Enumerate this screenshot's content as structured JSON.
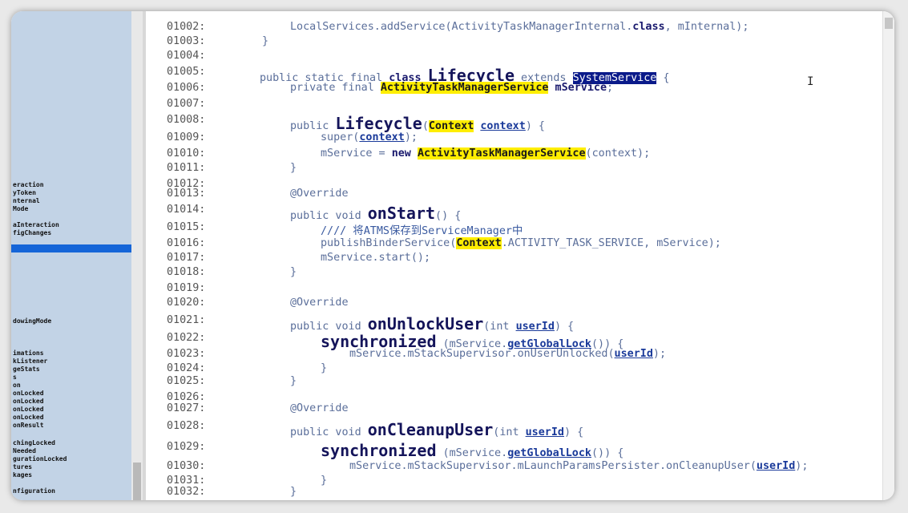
{
  "sidebar": {
    "items": [
      {
        "text": "eraction"
      },
      {
        "text": "yToken"
      },
      {
        "text": "nternal"
      },
      {
        "text": "Mode"
      },
      {
        "text": "aInteraction"
      },
      {
        "text": "figChanges"
      },
      {
        "text": "dowingMode"
      },
      {
        "text": "imations"
      },
      {
        "text": "kListener"
      },
      {
        "text": "geStats"
      },
      {
        "text": "s"
      },
      {
        "text": "on"
      },
      {
        "text": "onLocked"
      },
      {
        "text": "onLocked"
      },
      {
        "text": "onLocked"
      },
      {
        "text": "onLocked"
      },
      {
        "text": "onResult"
      },
      {
        "text": "chingLocked"
      },
      {
        "text": "Needed"
      },
      {
        "text": "gurationLocked"
      },
      {
        "text": "tures"
      },
      {
        "text": "kages"
      },
      {
        "text": "nfiguration"
      }
    ]
  },
  "code": {
    "lines": [
      {
        "no": "01002:",
        "t": [
          "LocalServices.addService(ActivityTaskManagerInternal.",
          "class",
          ", mInternal);"
        ]
      },
      {
        "no": "01003:",
        "t": [
          "}"
        ]
      },
      {
        "no": "01004:",
        "t": [
          ""
        ]
      },
      {
        "no": "01005:",
        "t": [
          "public static final ",
          "class",
          " ",
          "Lifecycle",
          " extends ",
          "SystemService",
          " {"
        ]
      },
      {
        "no": "01006:",
        "t": [
          "private final ",
          "ActivityTaskManagerService",
          " ",
          "mService",
          ";"
        ]
      },
      {
        "no": "01007:",
        "t": [
          ""
        ]
      },
      {
        "no": "01008:",
        "t": [
          "public ",
          "Lifecycle",
          "(",
          "Context",
          " ",
          "context",
          ") {"
        ]
      },
      {
        "no": "01009:",
        "t": [
          "super(",
          "context",
          ");"
        ]
      },
      {
        "no": "01010:",
        "t": [
          "mService = ",
          "new",
          " ",
          "ActivityTaskManagerService",
          "(context);"
        ]
      },
      {
        "no": "01011:",
        "t": [
          "}"
        ]
      },
      {
        "no": "01012:",
        "t": [
          ""
        ]
      },
      {
        "no": "01013:",
        "t": [
          "@Override"
        ]
      },
      {
        "no": "01014:",
        "t": [
          "public void ",
          "onStart",
          "() {"
        ]
      },
      {
        "no": "01015:",
        "t": [
          "//// 将ATMS保存到ServiceManager中"
        ]
      },
      {
        "no": "01016:",
        "t": [
          "publishBinderService(",
          "Context",
          ".ACTIVITY_TASK_SERVICE, mService);"
        ]
      },
      {
        "no": "01017:",
        "t": [
          "mService.start();"
        ]
      },
      {
        "no": "01018:",
        "t": [
          "}"
        ]
      },
      {
        "no": "01019:",
        "t": [
          ""
        ]
      },
      {
        "no": "01020:",
        "t": [
          "@Override"
        ]
      },
      {
        "no": "01021:",
        "t": [
          "public void ",
          "onUnlockUser",
          "(int ",
          "userId",
          ") {"
        ]
      },
      {
        "no": "01022:",
        "t": [
          "synchronized",
          " (mService.",
          "getGlobalLock",
          "()) {"
        ]
      },
      {
        "no": "01023:",
        "t": [
          "mService.mStackSupervisor.onUserUnlocked(",
          "userId",
          ");"
        ]
      },
      {
        "no": "01024:",
        "t": [
          "}"
        ]
      },
      {
        "no": "01025:",
        "t": [
          "}"
        ]
      },
      {
        "no": "01026:",
        "t": [
          ""
        ]
      },
      {
        "no": "01027:",
        "t": [
          "@Override"
        ]
      },
      {
        "no": "01028:",
        "t": [
          "public void ",
          "onCleanupUser",
          "(int ",
          "userId",
          ") {"
        ]
      },
      {
        "no": "01029:",
        "t": [
          "synchronized",
          " (mService.",
          "getGlobalLock",
          "()) {"
        ]
      },
      {
        "no": "01030:",
        "t": [
          "mService.mStackSupervisor.mLaunchParamsPersister.onCleanupUser(",
          "userId",
          ");"
        ]
      },
      {
        "no": "01031:",
        "t": [
          "}"
        ]
      },
      {
        "no": "01032:",
        "t": [
          "}"
        ]
      }
    ]
  }
}
